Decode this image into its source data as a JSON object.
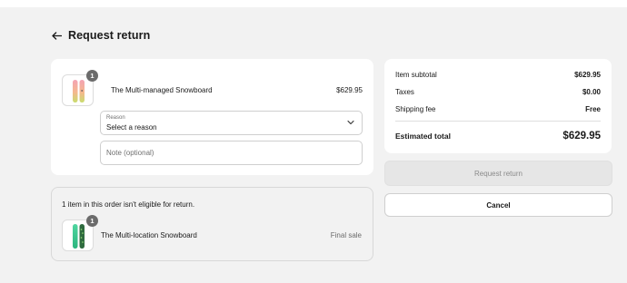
{
  "header": {
    "title": "Request return",
    "back_icon": "arrow-left-icon"
  },
  "return_item": {
    "name": "The Multi-managed Snowboard",
    "price": "$629.95",
    "quantity": "1",
    "reason": {
      "label": "Reason",
      "value": "Select a reason"
    },
    "note": {
      "placeholder": "Note (optional)",
      "value": ""
    }
  },
  "summary": {
    "subtotal_label": "Item subtotal",
    "subtotal_value": "$629.95",
    "taxes_label": "Taxes",
    "taxes_value": "$0.00",
    "shipping_label": "Shipping fee",
    "shipping_value": "Free",
    "total_label": "Estimated total",
    "total_value": "$629.95"
  },
  "actions": {
    "request_return_label": "Request return",
    "cancel_label": "Cancel"
  },
  "ineligible": {
    "message": "1 item in this order isn't eligible for return.",
    "item_name": "The Multi-location Snowboard",
    "item_quantity": "1",
    "status": "Final sale"
  },
  "colors": {
    "page_bg": "#f2f2f2",
    "card_bg": "#ffffff",
    "disabled_button_bg": "#e6e6e6",
    "badge_bg": "#6b6b6b"
  }
}
